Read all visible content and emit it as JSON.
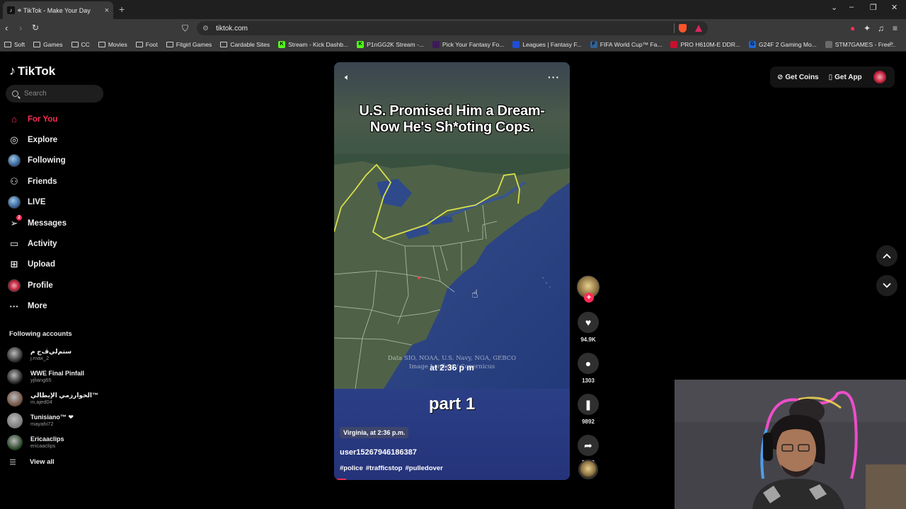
{
  "browser": {
    "tab_title": "TikTok - Make Your Day",
    "url": "tiktok.com",
    "bookmarks": [
      {
        "label": "Soft",
        "kind": "folder"
      },
      {
        "label": "Games",
        "kind": "folder"
      },
      {
        "label": "CC",
        "kind": "folder"
      },
      {
        "label": "Movies",
        "kind": "folder"
      },
      {
        "label": "Foot",
        "kind": "folder"
      },
      {
        "label": "Fitgirl Games",
        "kind": "folder"
      },
      {
        "label": "Cardable Sites",
        "kind": "folder"
      },
      {
        "label": "Stream - Kick Dashb...",
        "kind": "site",
        "color": "#53fc18",
        "glyph": "K"
      },
      {
        "label": "P1nGG2K Stream -...",
        "kind": "site",
        "color": "#53fc18",
        "glyph": "K"
      },
      {
        "label": "Pick Your Fantasy Fo...",
        "kind": "site",
        "color": "#3d195b",
        "glyph": ""
      },
      {
        "label": "Leagues | Fantasy F...",
        "kind": "site",
        "color": "#1d4ed8",
        "glyph": ""
      },
      {
        "label": "FIFA World Cup™ Fa...",
        "kind": "site",
        "color": "#326295",
        "glyph": "F"
      },
      {
        "label": "PRO H610M-E DDR...",
        "kind": "site",
        "color": "#c8102e",
        "glyph": ""
      },
      {
        "label": "G24F 2 Gaming Mo...",
        "kind": "site",
        "color": "#1e66d6",
        "glyph": "G"
      },
      {
        "label": "STM7GAMES - Free...",
        "kind": "site",
        "color": "#6a6a6a",
        "glyph": ""
      }
    ]
  },
  "sidebar": {
    "logo": "TikTok",
    "search_placeholder": "Search",
    "items": [
      {
        "label": "For You",
        "icon": "home-icon",
        "active": true
      },
      {
        "label": "Explore",
        "icon": "compass-icon"
      },
      {
        "label": "Following",
        "icon": "following-avatar-icon"
      },
      {
        "label": "Friends",
        "icon": "friends-icon"
      },
      {
        "label": "LIVE",
        "icon": "live-icon"
      },
      {
        "label": "Messages",
        "icon": "paper-plane-icon",
        "badge": "2"
      },
      {
        "label": "Activity",
        "icon": "activity-icon"
      },
      {
        "label": "Upload",
        "icon": "plus-square-icon"
      },
      {
        "label": "Profile",
        "icon": "profile-icon"
      },
      {
        "label": "More",
        "icon": "more-dots-icon"
      }
    ],
    "following_title": "Following accounts",
    "following": [
      {
        "name": "ستم‌لي‌ڤ‌ج‌ م",
        "handle": "j.max_2",
        "color": "#202020"
      },
      {
        "name": "WWE Final Pinfall",
        "handle": "yjliang65",
        "color": "#141414"
      },
      {
        "name": "الخوارزمي الإيطالي™",
        "handle": "m.ajed04",
        "color": "#6b4a3a"
      },
      {
        "name": "Tunisiano™ ❤",
        "handle": "mayahi72",
        "color": "#777777"
      },
      {
        "name": "Ericaaclips",
        "handle": "ericaaclips",
        "color": "#1b3b1b"
      }
    ],
    "view_all": "View all"
  },
  "video": {
    "headline_line1": "U.S. Promised Him a Dream-",
    "headline_line2": "Now He's Sh*oting Cops.",
    "map_credit_line1": "Data SIO, NOAA, U.S. Navy, NGA, GEBCO",
    "map_credit_line2": "Image Landsat / Copernicus",
    "time_caption": "at 2:36 p m",
    "part_label": "part 1",
    "location_tag": "Virginia, at 2:36 p.m.",
    "username": "user15267946186387",
    "hashtags": [
      "#police",
      "#trafficstop",
      "#pulledover"
    ],
    "progress": 0.05
  },
  "actions": {
    "likes": "94.9K",
    "comments": "1303",
    "saves": "9892",
    "shares": "5908"
  },
  "header": {
    "get_coins": "Get Coins",
    "get_app": "Get App"
  },
  "colors": {
    "accent": "#fe2c55",
    "ocean": "#2a4585",
    "land": "#4f6248"
  }
}
